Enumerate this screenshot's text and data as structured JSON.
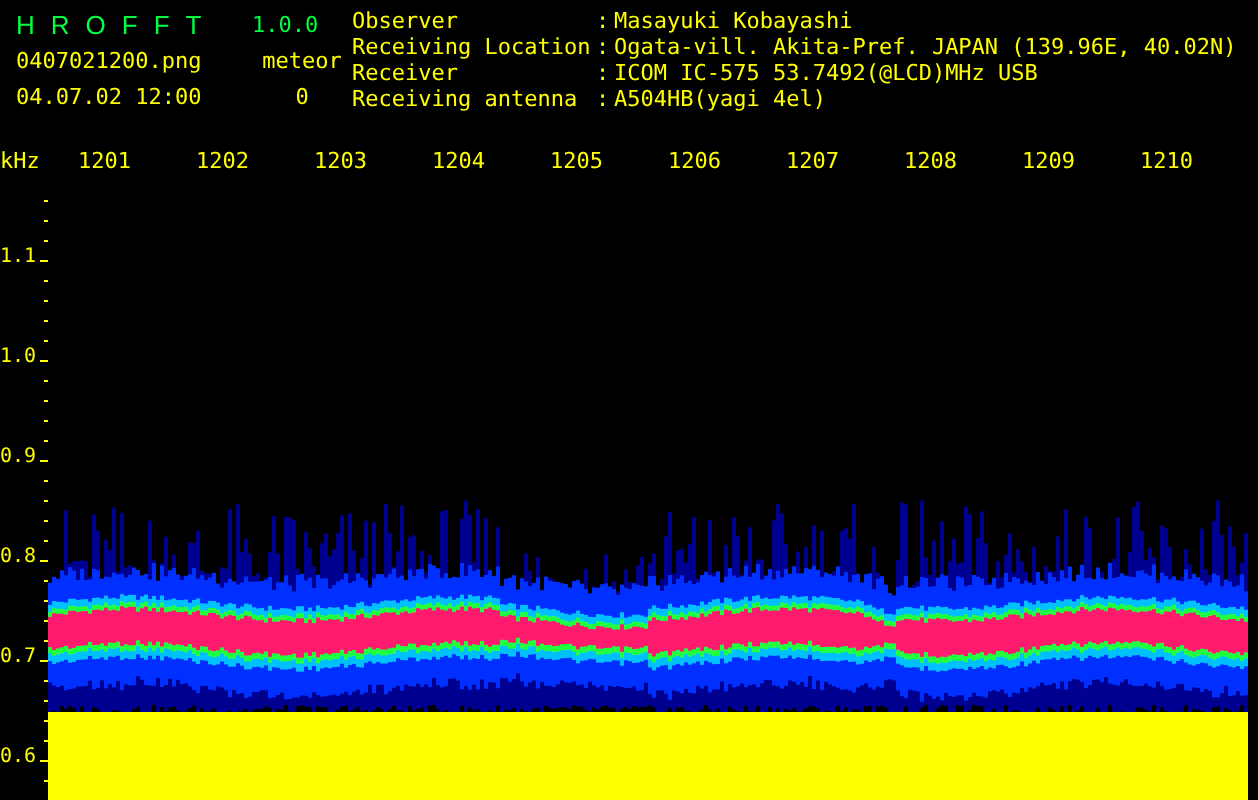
{
  "app": {
    "name": "HROFFT",
    "version": "1.0.0"
  },
  "file": {
    "name": "0407021200.png",
    "datetime": "04.07.02 12:00"
  },
  "meteor": {
    "label": "meteor",
    "count": "0"
  },
  "info": [
    {
      "label": "Observer",
      "value": "Masayuki Kobayashi"
    },
    {
      "label": "Receiving Location",
      "value": "Ogata-vill. Akita-Pref. JAPAN (139.96E, 40.02N)"
    },
    {
      "label": "Receiver",
      "value": "ICOM IC-575 53.7492(@LCD)MHz USB"
    },
    {
      "label": "Receiving antenna",
      "value": "A504HB(yagi 4el)"
    }
  ],
  "separator": ":",
  "plot": {
    "y_unit": "kHz",
    "x_labels": [
      "1201",
      "1202",
      "1203",
      "1204",
      "1205",
      "1206",
      "1207",
      "1208",
      "1209",
      "1210"
    ],
    "y_labels": [
      "1.1",
      "1.0",
      "0.9",
      "0.8",
      "0.7",
      "0.6"
    ]
  }
}
